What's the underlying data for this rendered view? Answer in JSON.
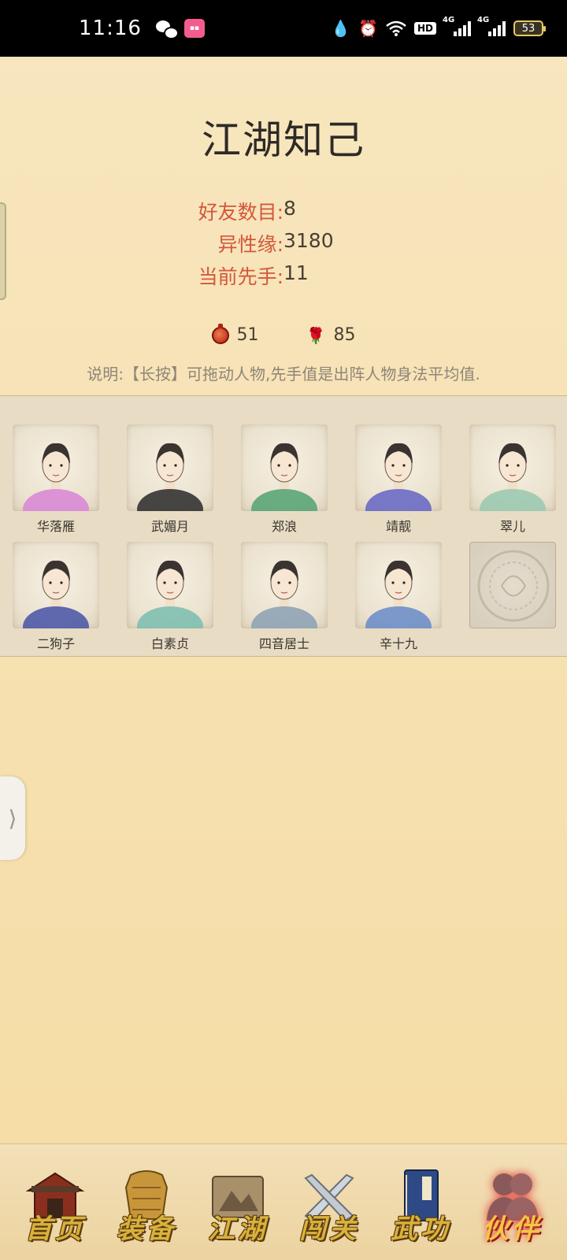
{
  "status_bar": {
    "time": "11:16",
    "hd_label": "HD",
    "network1": "4G",
    "network2": "4G",
    "battery": "53",
    "icons": [
      "wechat-icon",
      "bilibili-icon",
      "water-drop-icon",
      "alarm-icon",
      "wifi-icon",
      "signal-icon",
      "battery-icon"
    ]
  },
  "page": {
    "title": "江湖知己"
  },
  "stats": [
    {
      "label": "好友数目:",
      "value": "8"
    },
    {
      "label": "异性缘:",
      "value": "3180"
    },
    {
      "label": "当前先手:",
      "value": "11"
    }
  ],
  "currencies": {
    "gourd_value": "51",
    "rose_value": "85"
  },
  "note": "说明:【长按】可拖动人物,先手值是出阵人物身法平均值.",
  "characters": [
    {
      "name": "华落雁",
      "robe": "#d98ad6"
    },
    {
      "name": "武媚月",
      "robe": "#333333"
    },
    {
      "name": "郑浪",
      "robe": "#5aa577"
    },
    {
      "name": "靖靓",
      "robe": "#6a6bc4"
    },
    {
      "name": "翠儿",
      "robe": "#9cc9b0"
    },
    {
      "name": "二狗子",
      "robe": "#4f5aa8"
    },
    {
      "name": "白素贞",
      "robe": "#7fbfb0"
    },
    {
      "name": "四音居士",
      "robe": "#8fa3b5"
    },
    {
      "name": "辛十九",
      "robe": "#6f8fc9"
    }
  ],
  "side_handle_glyph": "⟩",
  "nav": [
    {
      "label": "首页",
      "icon": "house-icon"
    },
    {
      "label": "装备",
      "icon": "armor-icon"
    },
    {
      "label": "江湖",
      "icon": "scroll-map-icon"
    },
    {
      "label": "闯关",
      "icon": "crossed-swords-icon"
    },
    {
      "label": "武功",
      "icon": "book-icon"
    },
    {
      "label": "伙伴",
      "icon": "partners-icon",
      "active": true
    }
  ]
}
